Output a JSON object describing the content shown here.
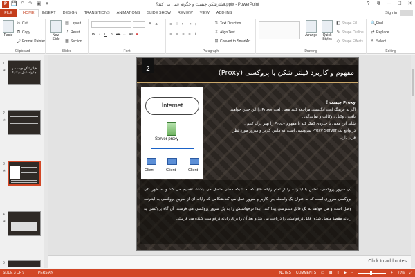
{
  "window": {
    "title": "فیلترشکن چیست و چگونه عمل می کند؟.pptx - PowerPoint",
    "app_icon": "P",
    "controls": [
      "?",
      "⧉",
      "─",
      "☐",
      "✕"
    ]
  },
  "qat": [
    "💾",
    "↶",
    "↷",
    "▣",
    "▾"
  ],
  "tabs": {
    "file": "FILE",
    "items": [
      "HOME",
      "INSERT",
      "DESIGN",
      "TRANSITIONS",
      "ANIMATIONS",
      "SLIDE SHOW",
      "REVIEW",
      "VIEW",
      "ADD-INS"
    ],
    "active": "HOME",
    "signin": "Sign in"
  },
  "ribbon": {
    "clipboard": {
      "label": "Clipboard",
      "paste": "Paste",
      "cut": "Cut",
      "copy": "Copy",
      "format_painter": "Format Painter"
    },
    "slides": {
      "label": "Slides",
      "new_slide": "New Slide",
      "layout": "Layout",
      "reset": "Reset",
      "section": "Section"
    },
    "font": {
      "label": "Font"
    },
    "paragraph": {
      "label": "Paragraph",
      "text_direction": "Text Direction",
      "align_text": "Align Text",
      "convert_smartart": "Convert to SmartArt"
    },
    "drawing": {
      "label": "Drawing",
      "arrange": "Arrange",
      "quick_styles": "Quick Styles",
      "shape_fill": "Shape Fill",
      "shape_outline": "Shape Outline",
      "shape_effects": "Shape Effects"
    },
    "editing": {
      "label": "Editing",
      "find": "Find",
      "replace": "Replace",
      "select": "Select"
    }
  },
  "thumbnails": [
    {
      "num": "1",
      "title": "فیلترشکن چیست و چگونه عمل میکند؟"
    },
    {
      "num": "2",
      "title": ""
    },
    {
      "num": "3",
      "title": ""
    },
    {
      "num": "4",
      "title": ""
    },
    {
      "num": "5",
      "title": ""
    }
  ],
  "slide": {
    "number": "2",
    "title": "مفهوم و کاربرد فیلتر شکن یا پروکسی (Proxy)",
    "diagram": {
      "internet": "Internet",
      "server": "Server proxy",
      "clients": [
        "Client",
        "Client",
        "Client"
      ]
    },
    "lines": [
      "Proxy چیست ؟",
      "اگر به فرهنگ لغت انگلیسی مراجعه کنید معنی لغت Proxy را این چنین خواهید",
      "یافت : وکیل ، وکالت و نمایندگی .",
      "شاید این معنی تا حدودی کمک کند تا مفهوم Proxy را بهتر درک کنیم .",
      "در واقع یک Proxy Server سرویسی است که مابین کاربر و سرور مورد نظر",
      "قرار دارد."
    ],
    "paragraph": "یک سرور پروکسی، تماس با اینترنت را از تمام رایانه های که به شبکه محلی متصل می باشند، تقسیم می کند و به طور کلی پروکسی سروری است که به عنوان یک واسطه بین کاربر و سرور عمل می کند.هنگامی که رایانه ای از طریق پروکسی به اینترنت وصل است و می خواهد به یک فایل دسترسی پیدا کند، ابتدا درخواستش را به یک سرور پروکسی می فرستد، آن گاه پروکسی به رایانه مقصد متصل شده، فایل درخواستی را دریافت می کند و بعد آن را برای رایانه درخواست کننده می فرستد."
  },
  "notes": {
    "placeholder": "Click to add notes"
  },
  "status": {
    "slide_of": "SLIDE 3 OF 9",
    "language": "PERSIAN",
    "notes": "NOTES",
    "comments": "COMMENTS",
    "zoom": "70%"
  },
  "colors": {
    "accent": "#d24726",
    "file_tab": "#c43e1c"
  }
}
